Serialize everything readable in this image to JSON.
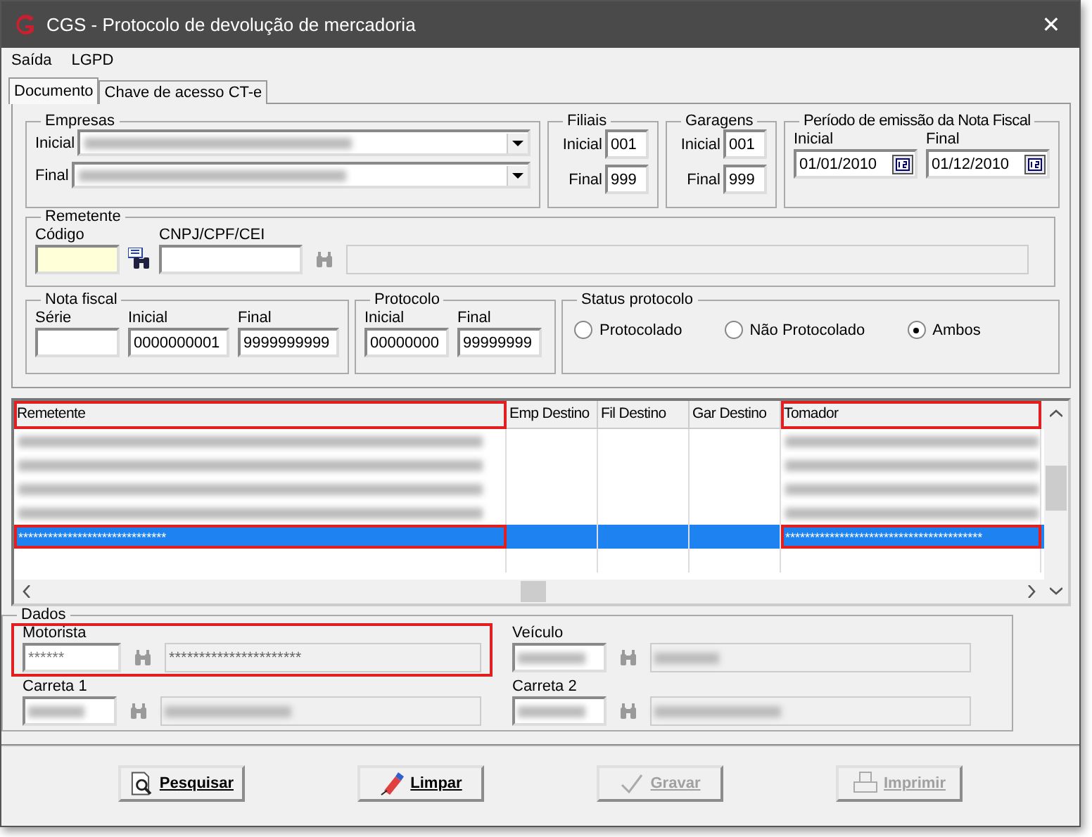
{
  "window": {
    "title": "CGS - Protocolo de devolução de mercadoria",
    "close": "✕"
  },
  "menu": [
    "Saída",
    "LGPD"
  ],
  "tabs": [
    {
      "label": "Documento",
      "selected": true
    },
    {
      "label": "Chave de acesso CT-e",
      "selected": false
    }
  ],
  "empresas": {
    "title": "Empresas",
    "rows": [
      {
        "label": "Inicial"
      },
      {
        "label": "Final"
      }
    ]
  },
  "filiais": {
    "title": "Filiais",
    "rows": [
      {
        "label": "Inicial",
        "value": "001"
      },
      {
        "label": "Final",
        "value": "999"
      }
    ]
  },
  "garagens": {
    "title": "Garagens",
    "rows": [
      {
        "label": "Inicial",
        "value": "001"
      },
      {
        "label": "Final",
        "value": "999"
      }
    ]
  },
  "periodo": {
    "title": "Período de emissão da Nota Fiscal",
    "fields": [
      {
        "label": "Inicial",
        "value": "01/01/2010"
      },
      {
        "label": "Final",
        "value": "01/12/2010"
      }
    ]
  },
  "remetente": {
    "title": "Remetente",
    "codigo_label": "Código",
    "cnpj_label": "CNPJ/CPF/CEI"
  },
  "nota_fiscal": {
    "title": "Nota fiscal",
    "fields": [
      {
        "label": "Série"
      },
      {
        "label": "Inicial",
        "value": "0000000001"
      },
      {
        "label": "Final",
        "value": "9999999999"
      }
    ]
  },
  "protocolo": {
    "title": "Protocolo",
    "fields": [
      {
        "label": "Inicial",
        "value": "00000000"
      },
      {
        "label": "Final",
        "value": "99999999"
      }
    ]
  },
  "status": {
    "title": "Status protocolo",
    "options": [
      {
        "label": "Protocolado",
        "selected": false
      },
      {
        "label": "Não Protocolado",
        "selected": false
      },
      {
        "label": "Ambos",
        "selected": true
      }
    ]
  },
  "grid": {
    "columns": [
      {
        "label": "Remetente",
        "highlighted": true
      },
      {
        "label": "Emp Destino",
        "highlighted": false
      },
      {
        "label": "Fil Destino",
        "highlighted": false
      },
      {
        "label": "Gar Destino",
        "highlighted": false
      },
      {
        "label": "Tomador",
        "highlighted": true
      }
    ],
    "rows": [
      {
        "kind": "blurred",
        "selected": false
      },
      {
        "kind": "blurred",
        "selected": false
      },
      {
        "kind": "blurred",
        "selected": false
      },
      {
        "kind": "blurred",
        "selected": false
      },
      {
        "kind": "text",
        "selected": true,
        "remetente": "******************************",
        "tomador": "****************************************"
      },
      {
        "kind": "empty",
        "selected": false
      }
    ]
  },
  "dados": {
    "title": "Dados",
    "fields": [
      {
        "label": "Motorista",
        "kind": "text",
        "code": "******",
        "name": "**********************",
        "highlighted": true
      },
      {
        "label": "Veículo",
        "kind": "blurred",
        "highlighted": false
      },
      {
        "label": "Carreta 1",
        "kind": "blurred",
        "highlighted": false
      },
      {
        "label": "Carreta 2",
        "kind": "blurred",
        "highlighted": false
      }
    ]
  },
  "buttons": [
    {
      "label": "Pesquisar",
      "disabled": false
    },
    {
      "label": "Limpar",
      "disabled": false
    },
    {
      "label": "Gravar",
      "disabled": true
    },
    {
      "label": "Imprimir",
      "disabled": true
    }
  ]
}
